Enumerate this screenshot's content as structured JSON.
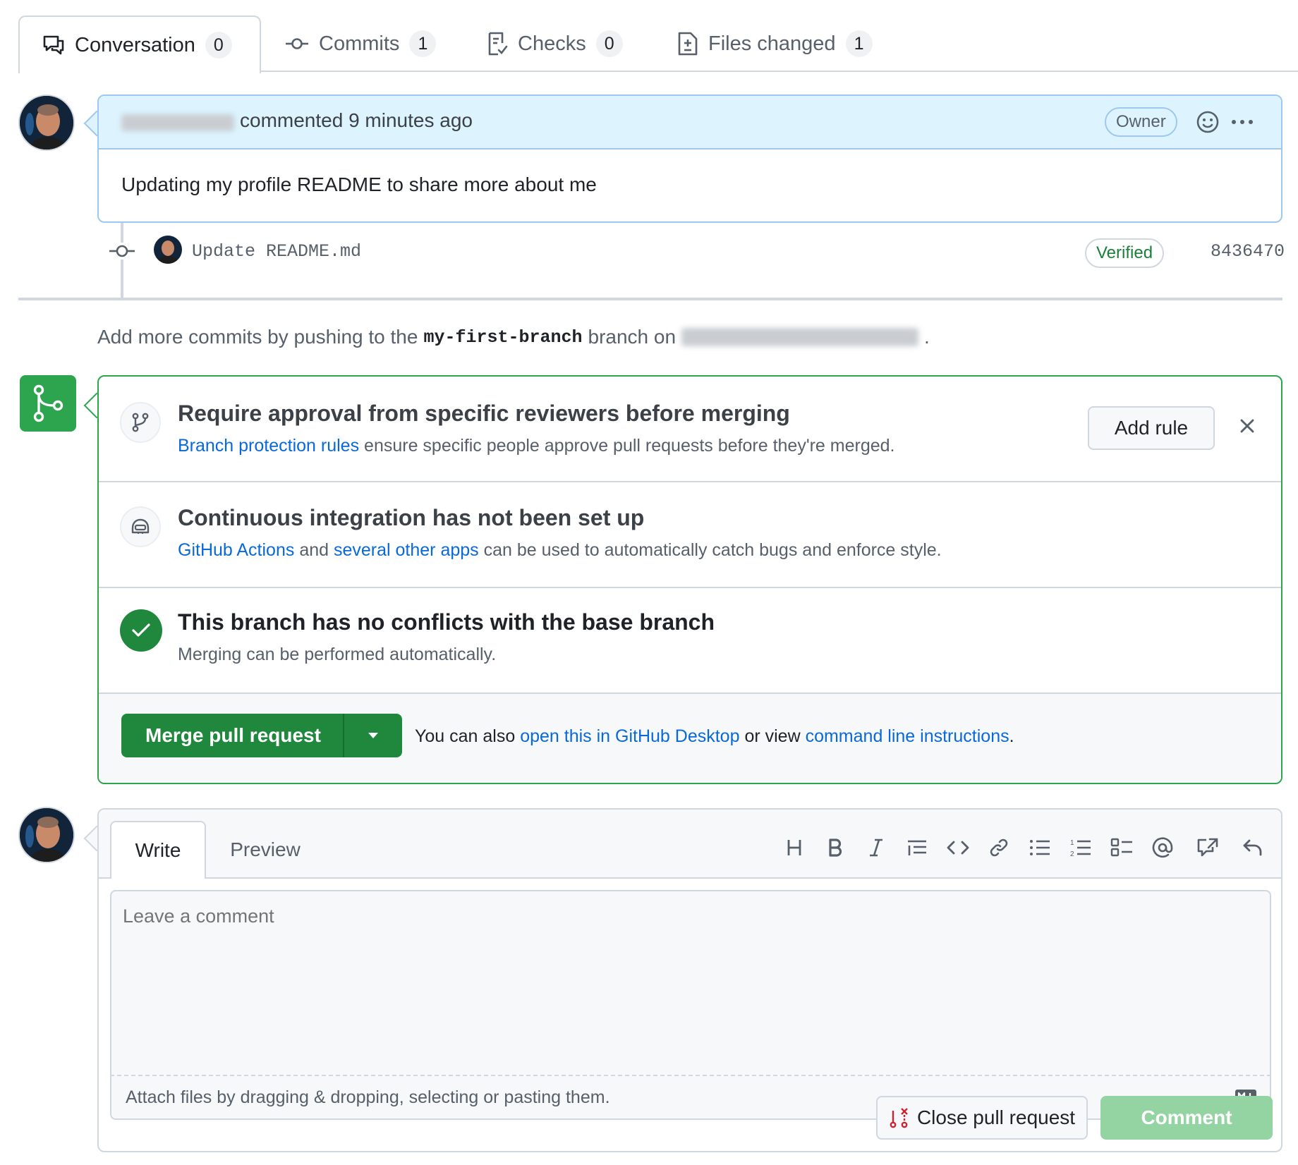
{
  "tabs": [
    {
      "label": "Conversation",
      "count": "0"
    },
    {
      "label": "Commits",
      "count": "1"
    },
    {
      "label": "Checks",
      "count": "0"
    },
    {
      "label": "Files changed",
      "count": "1"
    }
  ],
  "comment": {
    "action_text": "commented 9 minutes ago",
    "badge": "Owner",
    "body": "Updating my profile README to share more about me"
  },
  "commit": {
    "message": "Update README.md",
    "badge": "Verified",
    "sha": "8436470"
  },
  "push_hint": {
    "prefix": "Add more commits by pushing to the",
    "branch": "my-first-branch",
    "middle": "branch on",
    "suffix": "."
  },
  "merge": {
    "approval": {
      "title": "Require approval from specific reviewers before merging",
      "link": "Branch protection rules",
      "text": "ensure specific people approve pull requests before they're merged.",
      "button": "Add rule"
    },
    "ci": {
      "title": "Continuous integration has not been set up",
      "link1": "GitHub Actions",
      "and": "and",
      "link2": "several other apps",
      "text": "can be used to automatically catch bugs and enforce style."
    },
    "conflicts": {
      "title": "This branch has no conflicts with the base branch",
      "sub": "Merging can be performed automatically."
    },
    "footer": {
      "button": "Merge pull request",
      "prefix": "You can also",
      "link1": "open this in GitHub Desktop",
      "middle": "or view",
      "link2": "command line instructions",
      "suffix": "."
    }
  },
  "editor": {
    "tab_write": "Write",
    "tab_preview": "Preview",
    "placeholder": "Leave a comment",
    "attach": "Attach files by dragging & dropping, selecting or pasting them.",
    "close_button": "Close pull request",
    "comment_button": "Comment"
  },
  "colors": {
    "accent_link": "#0969da",
    "merge_green": "#1f883d",
    "comment_header_bg": "#ddf4ff"
  }
}
